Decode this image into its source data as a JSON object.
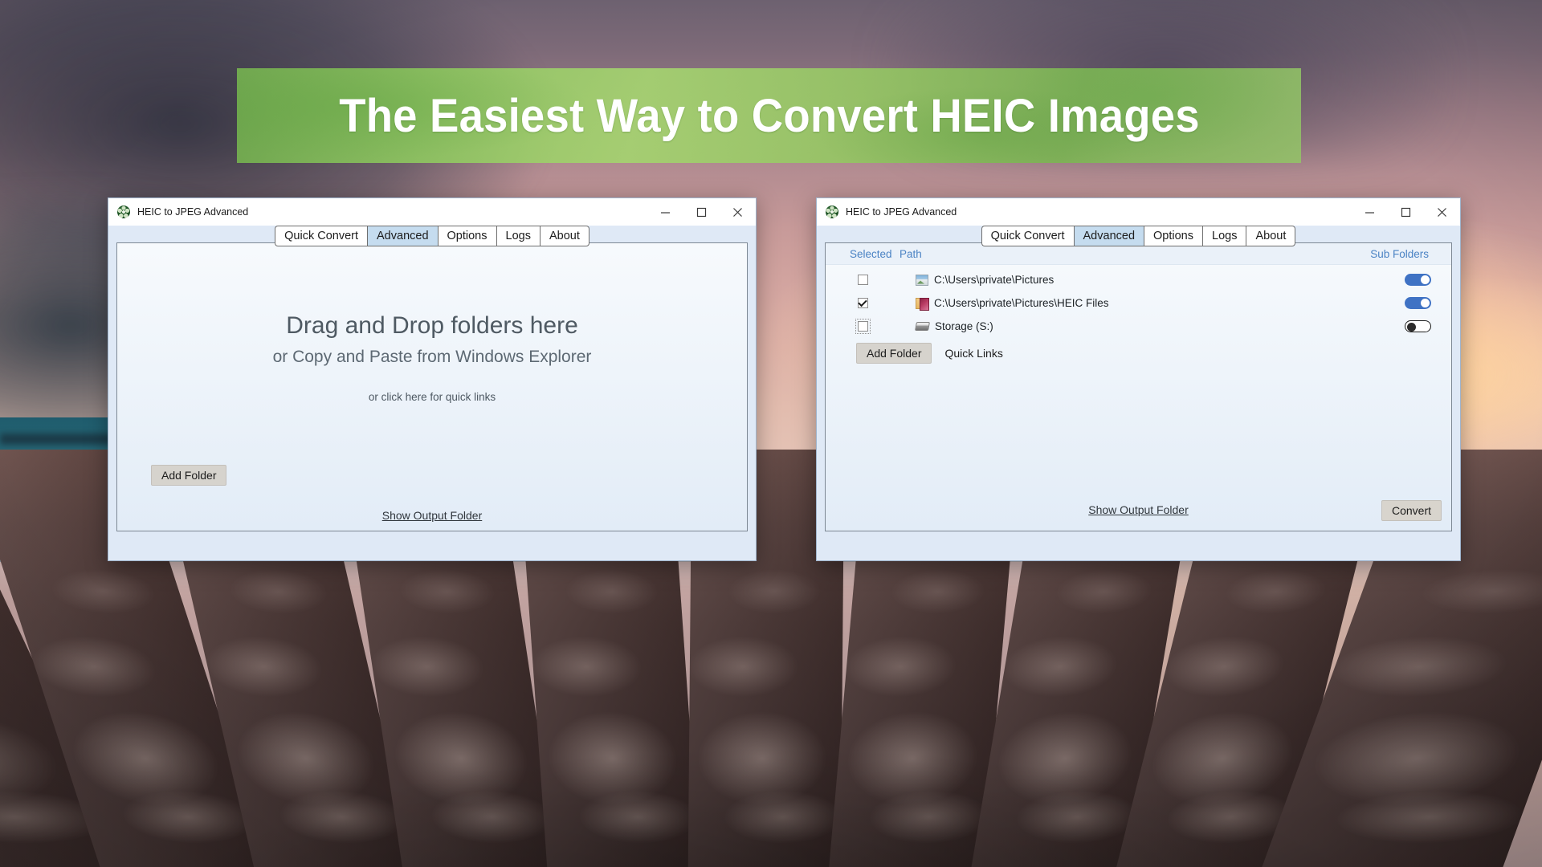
{
  "promo": {
    "banner_text": "The Easiest Way to Convert HEIC Images",
    "banner_color": "#92d060"
  },
  "window_left": {
    "title": "HEIC to JPEG Advanced",
    "icon": "app-flower-icon",
    "controls": {
      "minimize": "minimize-icon",
      "maximize": "maximize-icon",
      "close": "close-icon"
    },
    "tabs": [
      {
        "label": "Quick Convert",
        "selected": false
      },
      {
        "label": "Advanced",
        "selected": true
      },
      {
        "label": "Options",
        "selected": false
      },
      {
        "label": "Logs",
        "selected": false
      },
      {
        "label": "About",
        "selected": false
      }
    ],
    "dropzone": {
      "title": "Drag and Drop folders here",
      "subtitle": "or Copy and Paste from Windows Explorer",
      "hint": "or click here for quick links"
    },
    "add_folder_label": "Add Folder",
    "show_output_folder_label": "Show Output Folder"
  },
  "window_right": {
    "title": "HEIC to JPEG Advanced",
    "icon": "app-flower-icon",
    "controls": {
      "minimize": "minimize-icon",
      "maximize": "maximize-icon",
      "close": "close-icon"
    },
    "tabs": [
      {
        "label": "Quick Convert",
        "selected": false
      },
      {
        "label": "Advanced",
        "selected": true
      },
      {
        "label": "Options",
        "selected": false
      },
      {
        "label": "Logs",
        "selected": false
      },
      {
        "label": "About",
        "selected": false
      }
    ],
    "list": {
      "headers": {
        "selected": "Selected",
        "path": "Path",
        "sub_folders": "Sub Folders"
      },
      "header_color": "#4b83c4",
      "rows": [
        {
          "path": "C:\\Users\\private\\Pictures",
          "icon": "photo-icon",
          "checked": false,
          "focused": false,
          "sub_folders_on": true
        },
        {
          "path": "C:\\Users\\private\\Pictures\\HEIC Files",
          "icon": "folder-image-icon",
          "checked": true,
          "focused": false,
          "sub_folders_on": true
        },
        {
          "path": "Storage (S:)",
          "icon": "hard-drive-icon",
          "checked": false,
          "focused": true,
          "sub_folders_on": false
        }
      ]
    },
    "add_folder_label": "Add Folder",
    "quick_links_label": "Quick Links",
    "show_output_folder_label": "Show Output Folder",
    "convert_label": "Convert",
    "toggle_on_color": "#3f72c4"
  }
}
